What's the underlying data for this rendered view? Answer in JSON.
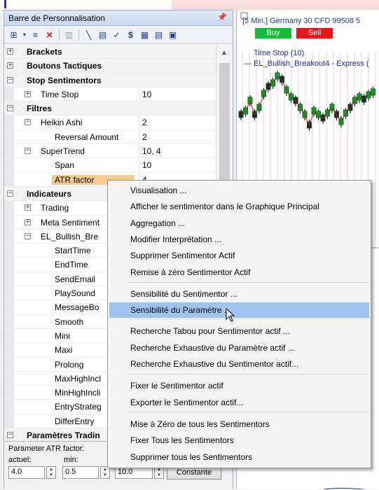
{
  "panel": {
    "title": "Barre de Personnalisation",
    "pin_icon": "⌖",
    "toolbar_icons": [
      "add-icon",
      "list-icon",
      "delete-icon",
      "disabled-icon",
      "chart-line-icon",
      "save-icon",
      "trend-icon",
      "dollar-icon",
      "grid-icon",
      "table-icon",
      "export-icon"
    ]
  },
  "tree": [
    {
      "label": "Brackets",
      "type": "cat",
      "toggle": "+",
      "level": 0,
      "value": ""
    },
    {
      "label": "Boutons Tactiques",
      "type": "cat",
      "toggle": "+",
      "level": 0,
      "value": ""
    },
    {
      "label": "Stop Sentimentors",
      "type": "cat",
      "toggle": "−",
      "level": 0,
      "value": ""
    },
    {
      "label": "Time Stop",
      "type": "item",
      "toggle": "+",
      "level": 1,
      "value": "10"
    },
    {
      "label": "Filtres",
      "type": "cat",
      "toggle": "−",
      "level": 0,
      "value": ""
    },
    {
      "label": "Heikin Ashi",
      "type": "item",
      "toggle": "−",
      "level": 1,
      "value": "2"
    },
    {
      "label": "Reversal Amount",
      "type": "item",
      "toggle": "",
      "level": 2,
      "value": "2"
    },
    {
      "label": "SuperTrend",
      "type": "item",
      "toggle": "−",
      "level": 1,
      "value": "10, 4"
    },
    {
      "label": "Span",
      "type": "item",
      "toggle": "",
      "level": 2,
      "value": "10"
    },
    {
      "label": "ATR factor",
      "type": "item",
      "toggle": "",
      "level": 2,
      "value": "4",
      "selected": true
    },
    {
      "label": "Indicateurs",
      "type": "cat",
      "toggle": "−",
      "level": 0,
      "value": ""
    },
    {
      "label": "Trading",
      "type": "item",
      "toggle": "+",
      "level": 1,
      "value": ""
    },
    {
      "label": "Meta Sentiment",
      "type": "item",
      "toggle": "+",
      "level": 1,
      "value": ""
    },
    {
      "label": "EL_Bullish_Bre",
      "type": "item",
      "toggle": "−",
      "level": 1,
      "value": ""
    },
    {
      "label": "StartTime",
      "type": "item",
      "toggle": "",
      "level": 2,
      "value": ""
    },
    {
      "label": "EndTime",
      "type": "item",
      "toggle": "",
      "level": 2,
      "value": ""
    },
    {
      "label": "SendEmail",
      "type": "item",
      "toggle": "",
      "level": 2,
      "value": ""
    },
    {
      "label": "PlaySound",
      "type": "item",
      "toggle": "",
      "level": 2,
      "value": ""
    },
    {
      "label": "MessageBo",
      "type": "item",
      "toggle": "",
      "level": 2,
      "value": ""
    },
    {
      "label": "Smooth",
      "type": "item",
      "toggle": "",
      "level": 2,
      "value": ""
    },
    {
      "label": "Mini",
      "type": "item",
      "toggle": "",
      "level": 2,
      "value": ""
    },
    {
      "label": "Maxi",
      "type": "item",
      "toggle": "",
      "level": 2,
      "value": ""
    },
    {
      "label": "Prolong",
      "type": "item",
      "toggle": "",
      "level": 2,
      "value": ""
    },
    {
      "label": "MaxHighIncl",
      "type": "item",
      "toggle": "",
      "level": 2,
      "value": ""
    },
    {
      "label": "MinHighIncli",
      "type": "item",
      "toggle": "",
      "level": 2,
      "value": ""
    },
    {
      "label": "EntryStrateg",
      "type": "item",
      "toggle": "",
      "level": 2,
      "value": ""
    },
    {
      "label": "DifferEntry",
      "type": "item",
      "toggle": "",
      "level": 2,
      "value": ""
    },
    {
      "label": "Paramètres Tradin",
      "type": "cat",
      "toggle": "−",
      "level": 0,
      "value": ""
    }
  ],
  "bottom": {
    "param_label": "Parameter ATR factor:",
    "actuel_label": "actuel:",
    "min_label": "min:",
    "actuel_value": "4.0",
    "min_value": "0.5",
    "max_value": "10.0",
    "constante_label": "Constante"
  },
  "chart": {
    "title": "[5 Min.] Germany 30 CFD  99508 5",
    "buy_label": "Buy",
    "sell_label": "Sell",
    "legend1": "Time Stop  (10)",
    "legend2": "EL_Bullish_Breakout4 - Express  (",
    "colors": {
      "buy": "#1bbb3a",
      "sell": "#e01a1a",
      "candle_up": "#0fa31f",
      "line": "#1e2f9a"
    }
  },
  "menu": {
    "items": [
      {
        "label": "Visualisation ..."
      },
      {
        "label": "Afficher le sentimentor dans le Graphique Principal"
      },
      {
        "label": "Aggregation ..."
      },
      {
        "label": "Modifier Interprétation ..."
      },
      {
        "label": "Supprimer Sentimentor Actif"
      },
      {
        "label": "Remise à zéro Sentimentor Actif"
      },
      {
        "label": "Sensibilité du Sentimentor ..."
      },
      {
        "label": "Sensibilité du Paramètre ..."
      },
      {
        "label": "Recherche Tabou pour Sentimentor actif ..."
      },
      {
        "label": "Recherche Exhaustive du Paramètre actif ..."
      },
      {
        "label": "Recherche Exhaustive du Sentimentor actif..."
      },
      {
        "label": "Fixer le Sentimentor actif"
      },
      {
        "label": "Exporter le  Sentimentor actif..."
      },
      {
        "label": "Mise à Zéro de tous les Sentimentors"
      },
      {
        "label": "Fixer Tous les Sentimentors"
      },
      {
        "label": "Supprimer tous les Sentimentors"
      }
    ],
    "highlighted_index": 7
  }
}
